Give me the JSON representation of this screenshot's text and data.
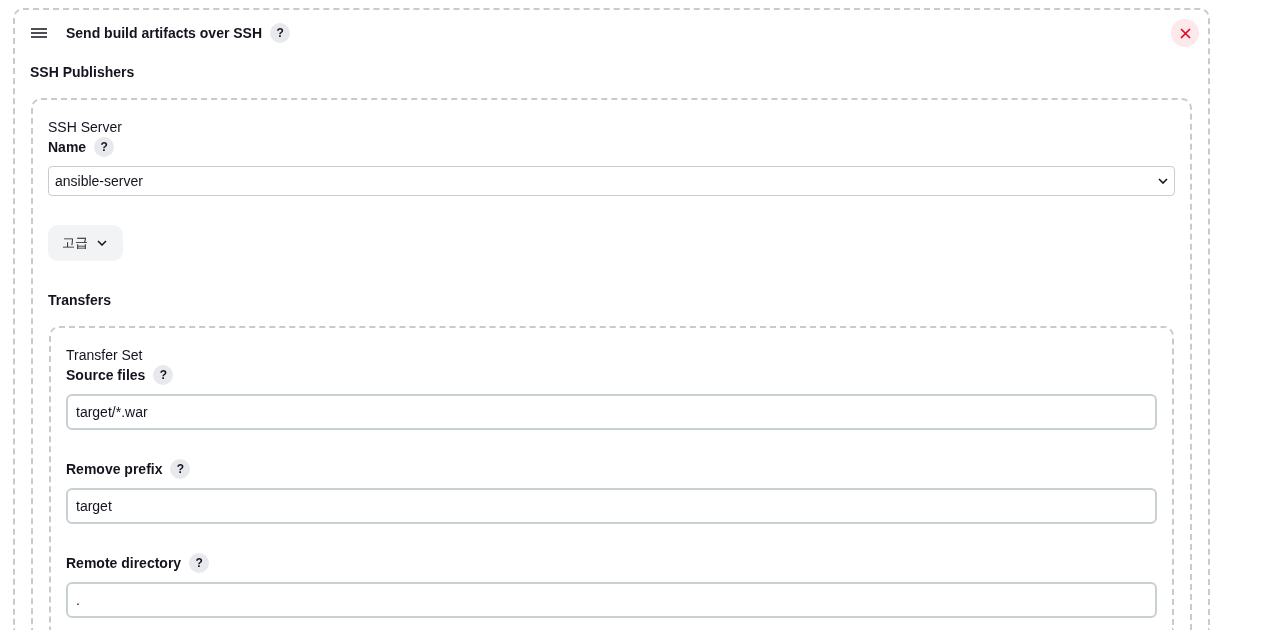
{
  "panel": {
    "title": "Send build artifacts over SSH",
    "help": "?"
  },
  "publishers": {
    "heading": "SSH Publishers"
  },
  "server": {
    "heading": "SSH Server",
    "name": {
      "label": "Name",
      "help": "?",
      "value": "ansible-server"
    },
    "advanced": {
      "label": "고급",
      "expanded": false
    }
  },
  "transfers": {
    "heading": "Transfers",
    "transfer_set": {
      "heading": "Transfer Set",
      "fields": [
        {
          "label": "Source files",
          "help": "?",
          "value": "target/*.war"
        },
        {
          "label": "Remove prefix",
          "help": "?",
          "value": "target"
        },
        {
          "label": "Remote directory",
          "help": "?",
          "value": "."
        }
      ]
    }
  }
}
